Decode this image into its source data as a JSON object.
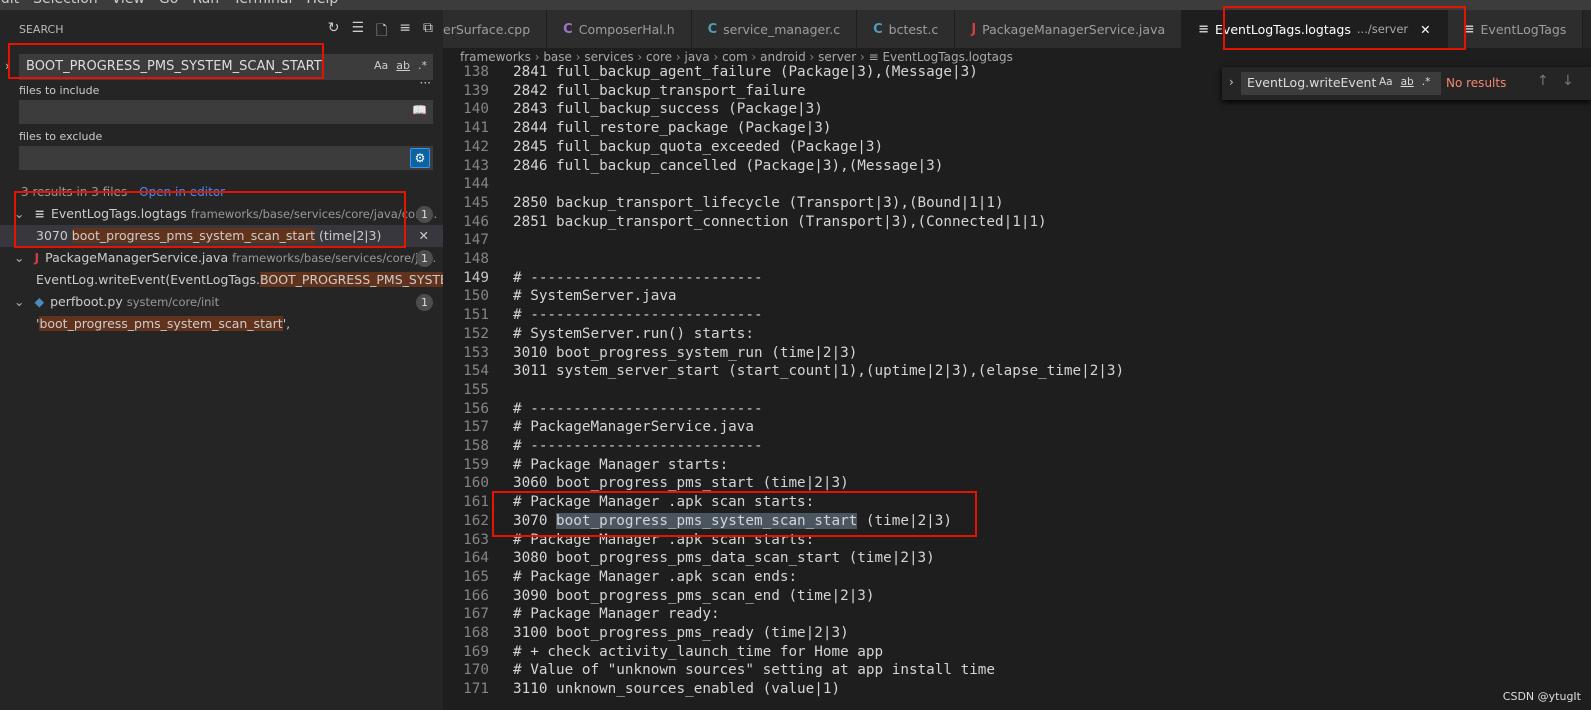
{
  "menu": [
    "Edit",
    "Selection",
    "View",
    "Go",
    "Run",
    "Terminal",
    "Help"
  ],
  "sidebar": {
    "title": "SEARCH",
    "query": "BOOT_PROGRESS_PMS_SYSTEM_SCAN_START",
    "opts": {
      "case": "Aa",
      "word": "ab",
      "regex": ".*"
    },
    "include_label": "files to include",
    "exclude_label": "files to exclude",
    "summary": "3 results in 3 files - ",
    "open_in_editor": "Open in editor",
    "results": [
      {
        "file": "EventLogTags.logtags",
        "path": "frameworks/base/services/core/java/com...",
        "count": "1",
        "icon": "lines-icon",
        "match": {
          "pre": "3070 ",
          "hit": "boot_progress_pms_system_scan_start",
          "post": " (time|2|3)"
        }
      },
      {
        "file": "PackageManagerService.java",
        "path": "frameworks/base/services/core/ja...",
        "count": "1",
        "icon": "java-icon",
        "match": {
          "pre": "EventLog.writeEvent(EventLogTags.",
          "hit": "BOOT_PROGRESS_PMS_SYSTE...",
          "post": ""
        }
      },
      {
        "file": "perfboot.py",
        "path": "system/core/init",
        "count": "1",
        "icon": "python-icon",
        "match": {
          "pre": "'",
          "hit": "boot_progress_pms_system_scan_start",
          "post": "',"
        }
      }
    ]
  },
  "tabs": [
    {
      "label": "erSurface.cpp",
      "icon": "",
      "color": "#519aba"
    },
    {
      "label": "ComposerHal.h",
      "icon": "C",
      "color": "#a074c4"
    },
    {
      "label": "service_manager.c",
      "icon": "C",
      "color": "#519aba"
    },
    {
      "label": "bctest.c",
      "icon": "C",
      "color": "#519aba"
    },
    {
      "label": "PackageManagerService.java",
      "icon": "J",
      "color": "#cc3e44"
    },
    {
      "label": "EventLogTags.logtags",
      "desc": ".../server",
      "icon": "≡",
      "color": "#ccc",
      "active": true
    },
    {
      "label": "EventLogTags",
      "icon": "≡",
      "color": "#ccc"
    }
  ],
  "breadcrumb": [
    "frameworks",
    "base",
    "services",
    "core",
    "java",
    "com",
    "android",
    "server",
    "EventLogTags.logtags"
  ],
  "find": {
    "value": "EventLog.writeEvent",
    "status": "No results",
    "opts": {
      "case": "Aa",
      "word": "ab",
      "regex": ".*"
    }
  },
  "lines": [
    {
      "n": "138",
      "t": "2841 full_backup_agent_failure (Package|3),(Message|3)"
    },
    {
      "n": "139",
      "t": "2842 full_backup_transport_failure"
    },
    {
      "n": "140",
      "t": "2843 full_backup_success (Package|3)"
    },
    {
      "n": "141",
      "t": "2844 full_restore_package (Package|3)"
    },
    {
      "n": "142",
      "t": "2845 full_backup_quota_exceeded (Package|3)"
    },
    {
      "n": "143",
      "t": "2846 full_backup_cancelled (Package|3),(Message|3)"
    },
    {
      "n": "144",
      "t": ""
    },
    {
      "n": "145",
      "t": "2850 backup_transport_lifecycle (Transport|3),(Bound|1|1)"
    },
    {
      "n": "146",
      "t": "2851 backup_transport_connection (Transport|3),(Connected|1|1)"
    },
    {
      "n": "147",
      "t": ""
    },
    {
      "n": "148",
      "t": ""
    },
    {
      "n": "149",
      "t": "# ---------------------------"
    },
    {
      "n": "150",
      "t": "# SystemServer.java"
    },
    {
      "n": "151",
      "t": "# ---------------------------"
    },
    {
      "n": "152",
      "t": "# SystemServer.run() starts:"
    },
    {
      "n": "153",
      "t": "3010 boot_progress_system_run (time|2|3)"
    },
    {
      "n": "154",
      "t": "3011 system_server_start (start_count|1),(uptime|2|3),(elapse_time|2|3)"
    },
    {
      "n": "155",
      "t": ""
    },
    {
      "n": "156",
      "t": "# ---------------------------"
    },
    {
      "n": "157",
      "t": "# PackageManagerService.java"
    },
    {
      "n": "158",
      "t": "# ---------------------------"
    },
    {
      "n": "159",
      "t": "# Package Manager starts:"
    },
    {
      "n": "160",
      "t": "3060 boot_progress_pms_start (time|2|3)"
    },
    {
      "n": "161",
      "t": "# Package Manager .apk scan starts:"
    },
    {
      "n": "162",
      "t": "3070 boot_progress_pms_system_scan_start (time|2|3)"
    },
    {
      "n": "163",
      "t": "# Package Manager .apk scan starts:"
    },
    {
      "n": "164",
      "t": "3080 boot_progress_pms_data_scan_start (time|2|3)"
    },
    {
      "n": "165",
      "t": "# Package Manager .apk scan ends:"
    },
    {
      "n": "166",
      "t": "3090 boot_progress_pms_scan_end (time|2|3)"
    },
    {
      "n": "167",
      "t": "# Package Manager ready:"
    },
    {
      "n": "168",
      "t": "3100 boot_progress_pms_ready (time|2|3)"
    },
    {
      "n": "169",
      "t": "# + check activity_launch_time for Home app"
    },
    {
      "n": "170",
      "t": "# Value of \"unknown sources\" setting at app install time"
    },
    {
      "n": "171",
      "t": "3110 unknown_sources_enabled (value|1)"
    }
  ],
  "selected_text": "boot_progress_pms_system_scan_start",
  "watermark": "CSDN @ytugIt"
}
